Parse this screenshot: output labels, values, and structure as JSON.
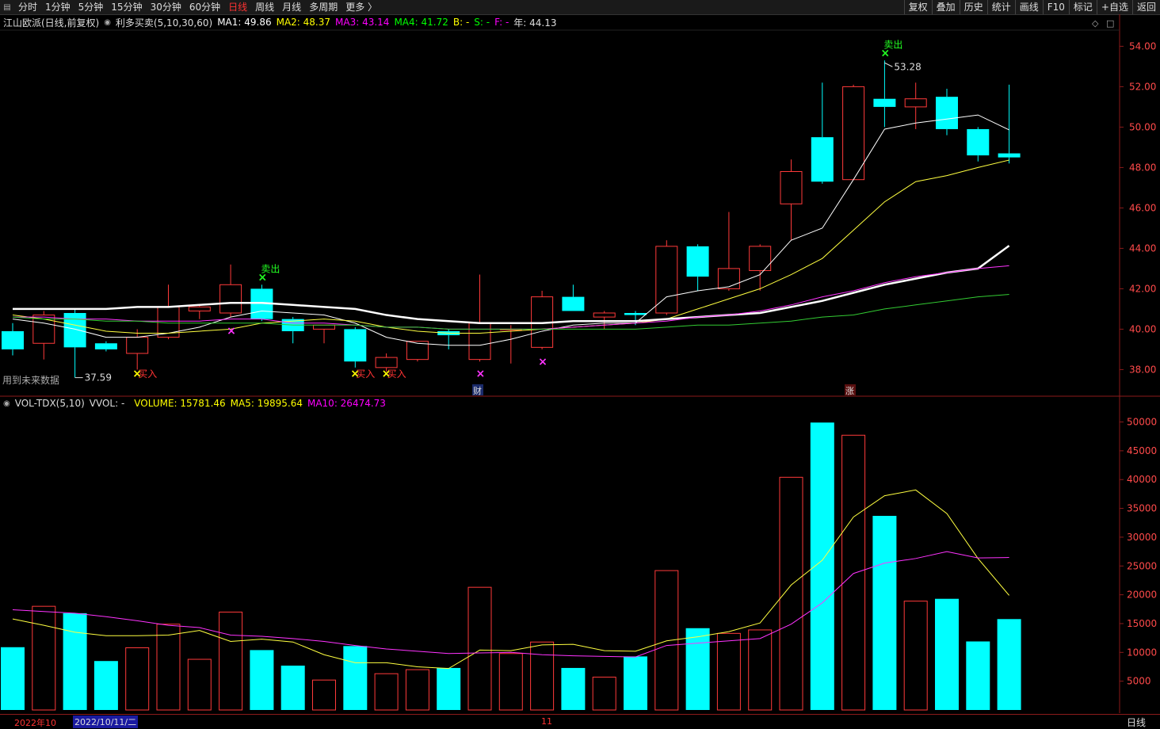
{
  "toolbar": {
    "periods": [
      "分时",
      "1分钟",
      "5分钟",
      "15分钟",
      "30分钟",
      "60分钟",
      "日线",
      "周线",
      "月线",
      "多周期",
      "更多 〉"
    ],
    "active_period": "日线",
    "right_buttons": [
      "复权",
      "叠加",
      "历史",
      "统计",
      "画线",
      "F10",
      "标记",
      "+自选",
      "返回"
    ]
  },
  "price_info": {
    "stock": "江山欧派(日线,前复权)",
    "indicator": "利多买卖(5,10,30,60)",
    "ma1": "MA1: 49.86",
    "ma2": "MA2: 48.37",
    "ma3": "MA3: 43.14",
    "ma4": "MA4: 41.72",
    "b": "B: -",
    "s": "S: -",
    "f": "F: -",
    "year": "年: 44.13"
  },
  "vol_info": {
    "name": "VOL-TDX(5,10)",
    "vvol": "VVOL: -",
    "volume": "VOLUME: 15781.46",
    "ma5": "MA5: 19895.64",
    "ma10": "MA10: 26474.73"
  },
  "notes": {
    "future_data": "用到未来数据",
    "cai": "财",
    "zhang": "涨",
    "buy": "买入",
    "sell": "卖出",
    "low_mark": "37.59",
    "high_mark": "53.28"
  },
  "bottom": {
    "date1": "2022年10",
    "date2": "2022/10/11/二",
    "date3": "11",
    "period": "日线"
  },
  "colors": {
    "up": "#ff3a3a",
    "down": "#00ffff",
    "ma1": "#ffffff",
    "ma2": "#ffff00",
    "ma3": "#ff00ff",
    "ma4": "#00ff00",
    "axis": "#8b1a1a"
  },
  "chart_data": [
    {
      "type": "candlestick",
      "title": "江山欧派(日线,前复权)",
      "ylim": [
        36.8,
        54.8
      ],
      "yticks": [
        38.0,
        40.0,
        42.0,
        44.0,
        46.0,
        48.0,
        50.0,
        52.0,
        54.0
      ],
      "candles": [
        {
          "o": 39.9,
          "h": 40.3,
          "l": 38.7,
          "c": 39.0
        },
        {
          "o": 39.3,
          "h": 40.9,
          "l": 38.5,
          "c": 40.7
        },
        {
          "o": 40.8,
          "h": 41.0,
          "l": 37.6,
          "c": 39.1
        },
        {
          "o": 39.3,
          "h": 39.4,
          "l": 38.9,
          "c": 39.0
        },
        {
          "o": 38.8,
          "h": 40.0,
          "l": 38.0,
          "c": 39.6
        },
        {
          "o": 39.6,
          "h": 42.2,
          "l": 39.5,
          "c": 41.1
        },
        {
          "o": 40.9,
          "h": 41.2,
          "l": 40.5,
          "c": 41.1
        },
        {
          "o": 40.8,
          "h": 43.2,
          "l": 40.6,
          "c": 42.2
        },
        {
          "o": 42.0,
          "h": 42.2,
          "l": 40.4,
          "c": 40.5
        },
        {
          "o": 40.5,
          "h": 40.6,
          "l": 39.3,
          "c": 39.9
        },
        {
          "o": 40.0,
          "h": 40.2,
          "l": 39.3,
          "c": 40.2
        },
        {
          "o": 40.0,
          "h": 40.1,
          "l": 38.1,
          "c": 38.4
        },
        {
          "o": 38.1,
          "h": 38.8,
          "l": 37.9,
          "c": 38.6
        },
        {
          "o": 38.5,
          "h": 39.4,
          "l": 38.4,
          "c": 39.4
        },
        {
          "o": 39.9,
          "h": 40.0,
          "l": 39.0,
          "c": 39.7
        },
        {
          "o": 38.5,
          "h": 42.7,
          "l": 38.4,
          "c": 40.3
        },
        {
          "o": 40.0,
          "h": 40.2,
          "l": 38.3,
          "c": 40.0
        },
        {
          "o": 39.1,
          "h": 41.9,
          "l": 39.0,
          "c": 41.6
        },
        {
          "o": 41.6,
          "h": 42.2,
          "l": 40.9,
          "c": 40.9
        },
        {
          "o": 40.6,
          "h": 40.9,
          "l": 40.0,
          "c": 40.8
        },
        {
          "o": 40.8,
          "h": 40.9,
          "l": 40.2,
          "c": 40.7
        },
        {
          "o": 40.8,
          "h": 44.4,
          "l": 40.7,
          "c": 44.1
        },
        {
          "o": 44.1,
          "h": 44.2,
          "l": 41.9,
          "c": 42.6
        },
        {
          "o": 42.0,
          "h": 45.8,
          "l": 41.9,
          "c": 43.0
        },
        {
          "o": 42.9,
          "h": 44.2,
          "l": 41.9,
          "c": 44.1
        },
        {
          "o": 46.2,
          "h": 48.4,
          "l": 44.4,
          "c": 47.8
        },
        {
          "o": 49.5,
          "h": 52.2,
          "l": 47.2,
          "c": 47.3
        },
        {
          "o": 47.4,
          "h": 52.1,
          "l": 47.4,
          "c": 52.0
        },
        {
          "o": 51.4,
          "h": 53.3,
          "l": 50.0,
          "c": 51.0
        },
        {
          "o": 51.0,
          "h": 52.2,
          "l": 49.9,
          "c": 51.4
        },
        {
          "o": 51.5,
          "h": 51.9,
          "l": 49.6,
          "c": 49.9
        },
        {
          "o": 49.9,
          "h": 50.0,
          "l": 48.3,
          "c": 48.6
        },
        {
          "o": 48.7,
          "h": 52.1,
          "l": 48.2,
          "c": 48.5
        }
      ],
      "series": [
        {
          "name": "MA1",
          "values": [
            40.5,
            40.3,
            40.0,
            39.6,
            39.6,
            39.8,
            40.1,
            40.6,
            40.9,
            40.8,
            40.7,
            40.3,
            39.6,
            39.3,
            39.2,
            39.2,
            39.5,
            39.9,
            40.2,
            40.3,
            40.3,
            41.6,
            41.9,
            42.1,
            42.7,
            44.4,
            45.0,
            47.4,
            49.9,
            50.2,
            50.4,
            50.6,
            49.86
          ]
        },
        {
          "name": "MA2",
          "values": [
            40.7,
            40.5,
            40.2,
            39.9,
            39.8,
            39.8,
            39.9,
            40.0,
            40.3,
            40.4,
            40.5,
            40.4,
            40.1,
            39.9,
            39.8,
            39.8,
            39.9,
            40.0,
            40.1,
            40.2,
            40.3,
            40.5,
            41.0,
            41.5,
            42.0,
            42.7,
            43.5,
            44.9,
            46.3,
            47.3,
            47.6,
            48.0,
            48.37
          ]
        },
        {
          "name": "MA3",
          "values": [
            41.0,
            41.0,
            41.0,
            41.0,
            41.1,
            41.1,
            41.2,
            41.3,
            41.3,
            41.2,
            41.1,
            41.0,
            40.7,
            40.5,
            40.4,
            40.3,
            40.3,
            40.3,
            40.4,
            40.4,
            40.4,
            40.5,
            40.6,
            40.7,
            40.8,
            41.1,
            41.4,
            41.8,
            42.2,
            42.5,
            42.8,
            43.0,
            44.13
          ]
        },
        {
          "name": "MA4",
          "values": [
            40.6,
            40.6,
            40.5,
            40.5,
            40.4,
            40.4,
            40.4,
            40.5,
            40.5,
            40.3,
            40.3,
            40.2,
            40.1,
            40.1,
            40.0,
            40.0,
            40.0,
            40.0,
            40.1,
            40.2,
            40.3,
            40.4,
            40.6,
            40.7,
            40.9,
            41.2,
            41.6,
            41.9,
            42.3,
            42.6,
            42.8,
            43.0,
            43.14
          ]
        },
        {
          "name": "MA5",
          "values": [
            40.6,
            40.5,
            40.5,
            40.4,
            40.4,
            40.3,
            40.3,
            40.3,
            40.3,
            40.2,
            40.2,
            40.2,
            40.1,
            40.1,
            40.0,
            40.0,
            40.0,
            40.0,
            40.0,
            40.0,
            40.0,
            40.1,
            40.2,
            40.2,
            40.3,
            40.4,
            40.6,
            40.7,
            41.0,
            41.2,
            41.4,
            41.6,
            41.72
          ]
        }
      ],
      "markers": {
        "sell": [
          8,
          28
        ],
        "buy": [
          4,
          11,
          12
        ],
        "magenta_x": [
          7,
          15,
          17
        ]
      }
    },
    {
      "type": "bar",
      "title": "VOL-TDX(5,10)",
      "ylim": [
        0,
        52000
      ],
      "yticks": [
        5000,
        10000,
        15000,
        20000,
        25000,
        30000,
        35000,
        40000,
        45000,
        50000
      ],
      "values": [
        10900,
        18000,
        16800,
        8500,
        10800,
        14900,
        8800,
        17000,
        10400,
        7700,
        5200,
        11100,
        6300,
        7000,
        7300,
        21300,
        9800,
        11800,
        7300,
        5700,
        9300,
        24200,
        14200,
        13300,
        13900,
        40400,
        49900,
        47700,
        33700,
        18900,
        19300,
        11900,
        15781
      ],
      "ma5": [
        15800,
        14700,
        13500,
        12900,
        12900,
        13000,
        13800,
        11900,
        12300,
        11800,
        9600,
        8200,
        8200,
        7500,
        7200,
        10400,
        10300,
        11300,
        11400,
        10300,
        10200,
        12000,
        12700,
        13600,
        15100,
        21700,
        26000,
        33500,
        37200,
        38200,
        34100,
        26300,
        19895
      ],
      "ma10": [
        17400,
        17100,
        16800,
        16200,
        15500,
        14700,
        14300,
        13000,
        12800,
        12400,
        11900,
        11200,
        10600,
        10200,
        9800,
        9900,
        10000,
        9600,
        9400,
        9300,
        9200,
        11200,
        11600,
        12000,
        12400,
        14900,
        18600,
        23700,
        25500,
        26300,
        27500,
        26400,
        26474
      ]
    }
  ]
}
